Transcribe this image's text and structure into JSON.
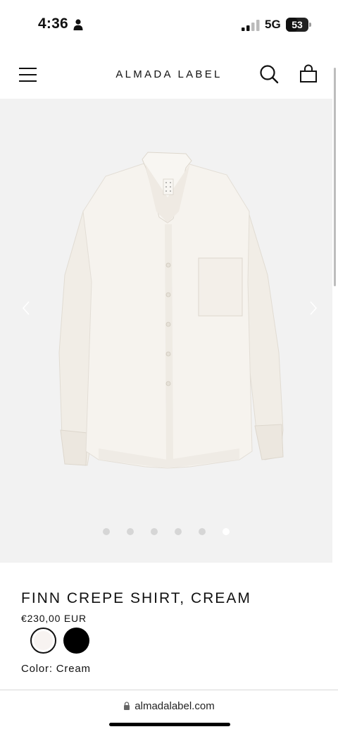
{
  "status_bar": {
    "time": "4:36",
    "network": "5G",
    "battery_level": "53",
    "icons": [
      "person-icon",
      "signal-icon",
      "battery-icon"
    ]
  },
  "header": {
    "brand": "ALMADA LABEL",
    "icons": [
      "menu-icon",
      "search-icon",
      "bag-icon"
    ]
  },
  "gallery": {
    "image": "cream-shirt-product-photo",
    "slide_count": 6,
    "active_slide": 6,
    "background": "#f2f2f2",
    "icons": [
      "chevron-left-icon",
      "chevron-right-icon"
    ]
  },
  "product": {
    "title": "FINN CREPE SHIRT, CREAM",
    "price": "€230,00 EUR",
    "swatches": [
      {
        "name": "Cream",
        "color": "#f7f3f1",
        "selected": true
      },
      {
        "name": "Black",
        "color": "#000000",
        "selected": false
      }
    ],
    "color_label": "Color:",
    "color_value": "Cream"
  },
  "browser": {
    "url": "almadalabel.com",
    "icons": [
      "lock-icon"
    ]
  }
}
